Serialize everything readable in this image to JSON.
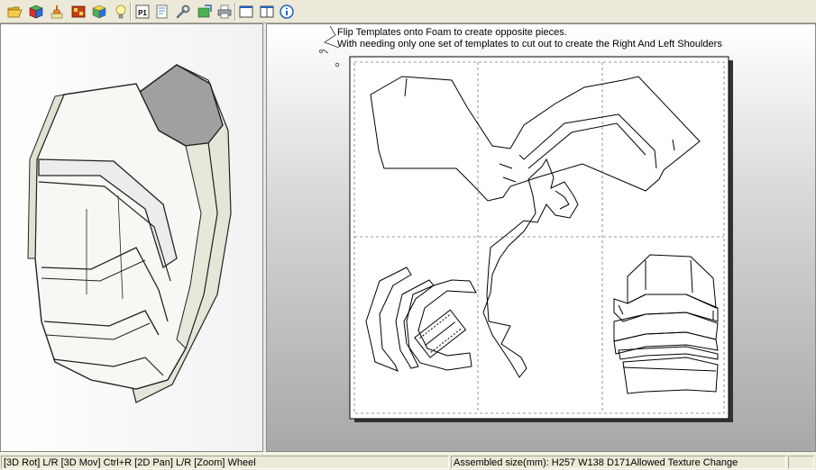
{
  "toolbar": {
    "buttons": [
      {
        "name": "open-file-button",
        "icon": "folder-open-icon"
      },
      {
        "name": "unfold-button",
        "icon": "cube-icon"
      },
      {
        "name": "edit-mode-button",
        "icon": "brush-icon"
      },
      {
        "name": "texture-button",
        "icon": "texture-icon"
      },
      {
        "name": "color-cube-button",
        "icon": "color-cube-icon"
      },
      {
        "name": "lighting-button",
        "icon": "light-bulb-icon"
      },
      {
        "name": "page-button",
        "icon": "page-number-icon",
        "label": "P1"
      },
      {
        "name": "print-layout-button",
        "icon": "print-layout-icon"
      },
      {
        "name": "settings-button",
        "icon": "wrench-icon"
      },
      {
        "name": "export-button",
        "icon": "export-icon"
      },
      {
        "name": "print-button",
        "icon": "printer-icon"
      },
      {
        "name": "single-pane-button",
        "icon": "window-icon"
      },
      {
        "name": "split-pane-button",
        "icon": "window-split-icon"
      },
      {
        "name": "about-button",
        "icon": "info-icon"
      }
    ]
  },
  "canvas": {
    "note_line1": "Flip Templates onto Foam to create opposite pieces.",
    "note_line2": "With needing only one set of templates to cut out to create the Right And Left Shoulders"
  },
  "status": {
    "controls": "[3D Rot] L/R [3D Mov] Ctrl+R [2D Pan] L/R [Zoom] Wheel",
    "assembled": "Assembled size(mm): H257 W138 D171Allowed Texture Change"
  },
  "colors": {
    "chrome": "#ece9d8",
    "accent_blue": "#2060c0",
    "sheet_white": "#ffffff",
    "cut_line": "#000000"
  }
}
